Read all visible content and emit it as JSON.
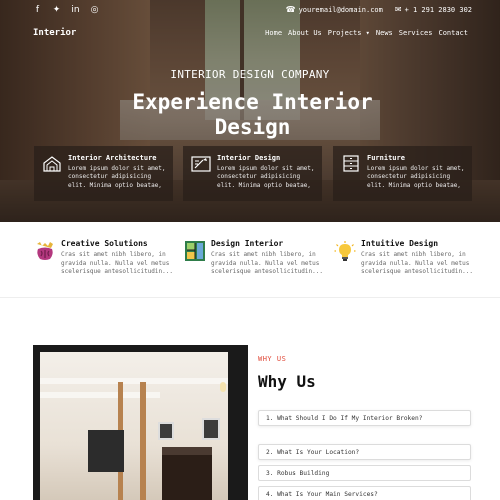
{
  "topbar": {
    "social_icons": [
      "facebook-icon",
      "twitter-icon",
      "linkedin-icon",
      "instagram-icon"
    ],
    "social_glyphs": [
      "f",
      "✦",
      "in",
      "◎"
    ],
    "email_icon": "☎",
    "email": "youremail@domain.com",
    "phone_icon": "✉",
    "phone": "+ 1 291 2830 302"
  },
  "navbar": {
    "brand": "Interior",
    "menu": [
      "Home",
      "About Us",
      "Projects ▾",
      "News",
      "Services",
      "Contact"
    ]
  },
  "hero": {
    "subtitle": "INTERIOR DESIGN COMPANY",
    "title": "Experience Interior Design",
    "features": [
      {
        "title": "Interior Architecture",
        "description": "Lorem ipsum dolor sit amet, consectetur adipisicing elit. Minima optio beatae,"
      },
      {
        "title": "Interior Design",
        "description": "Lorem ipsum dolor sit amet, consectetur adipisicing elit. Minima optio beatae,"
      },
      {
        "title": "Furniture",
        "description": "Lorem ipsum dolor sit amet, consectetur adipisicing elit. Minima optio beatae,"
      }
    ]
  },
  "services": [
    {
      "title": "Creative Solutions",
      "description": "Cras sit amet nibh libero, in gravida nulla. Nulla vel metus scelerisque antesollicitudin..."
    },
    {
      "title": "Design Interior",
      "description": "Cras sit amet nibh libero, in gravida nulla. Nulla vel metus scelerisque antesollicitudin..."
    },
    {
      "title": "Intuitive Design",
      "description": "Cras sit amet nibh libero, in gravida nulla. Nulla vel metus scelerisque antesollicitudin..."
    }
  ],
  "why_us": {
    "label": "WHY US",
    "title": "Why Us",
    "faqs": [
      "1. What Should I Do If My Interior Broken?",
      "2. What Is Your Location?",
      "3. Robus Building",
      "4. What Is Your Main Services?"
    ]
  },
  "colors": {
    "accent_red": "#e04a3a",
    "text_dark": "#111111"
  }
}
